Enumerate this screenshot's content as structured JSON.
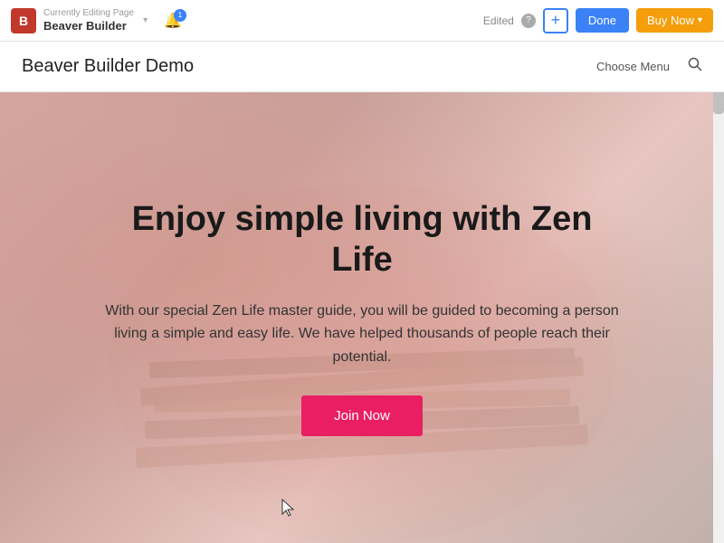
{
  "adminBar": {
    "logoText": "B",
    "subtitle": "Currently Editing Page",
    "title": "Beaver Builder",
    "dropdownArrow": "▾",
    "bellIcon": "🔔",
    "bellBadge": "1",
    "editedLabel": "Edited",
    "helpIcon": "?",
    "plusIcon": "+",
    "doneLabel": "Done",
    "buyNowLabel": "Buy Now",
    "buyNowArrow": "▾"
  },
  "siteHeader": {
    "title": "Beaver Builder Demo",
    "chooseMenu": "Choose Menu",
    "searchIcon": "🔍"
  },
  "hero": {
    "title": "Enjoy simple living with Zen Life",
    "description": "With our special Zen Life master guide, you will be guided to becoming a person living a simple and easy life. We have helped thousands of people reach their potential.",
    "joinNowLabel": "Join Now"
  },
  "colors": {
    "accentBlue": "#3b82f6",
    "accentYellow": "#f59e0b",
    "accentPink": "#e91e63"
  }
}
